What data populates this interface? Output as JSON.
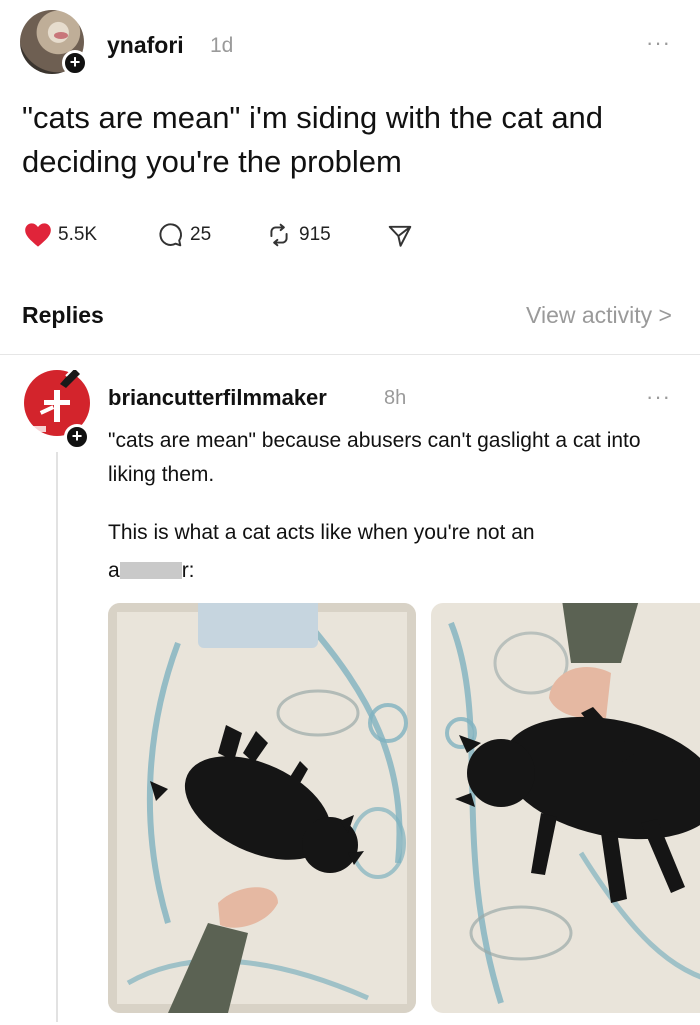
{
  "post": {
    "username": "ynafori",
    "time": "1d",
    "more": "···",
    "text": "\"cats are mean\" i'm siding with the cat and deciding you're the problem",
    "actions": {
      "likes": "5.5K",
      "replies": "25",
      "reposts": "915"
    }
  },
  "replies_bar": {
    "label": "Replies",
    "view_activity": "View activity >"
  },
  "reply": {
    "username": "briancutterfilmmaker",
    "time": "8h",
    "more": "···",
    "text1": "\"cats are mean\" because abusers can't gaslight a cat into liking them.",
    "text2_line1": "This is what a cat acts like when you're not an",
    "text2_start": "a",
    "text2_end": "r:",
    "photos": [
      "photo-cat-lying-on-rug-with-hand",
      "photo-cat-stretched-on-rug"
    ]
  },
  "colors": {
    "like": "#e0243a",
    "muted": "#9a9a9a",
    "avatar_reply": "#d3242c",
    "rug": "#e9e4da",
    "rug_pattern": "#7fb2bf",
    "cat": "#151515"
  },
  "icons": [
    "heart-icon",
    "comment-icon",
    "repost-icon",
    "share-icon",
    "plus-icon",
    "more-icon"
  ]
}
